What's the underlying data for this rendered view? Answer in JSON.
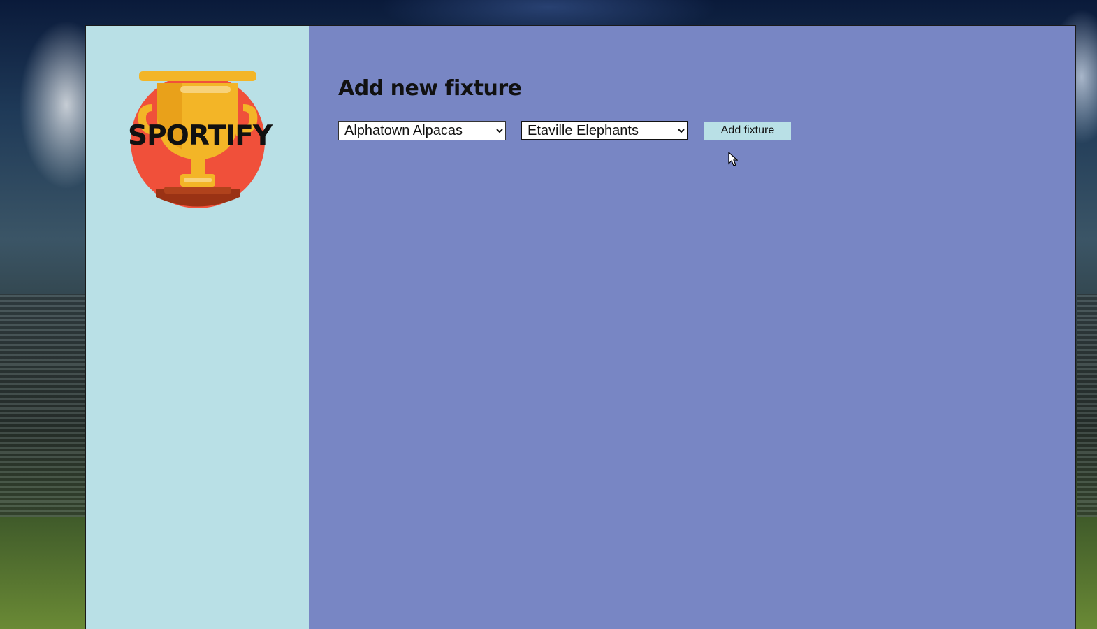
{
  "brand": {
    "name": "SPORTIFY",
    "colors": {
      "trophy": "#f3b527",
      "circle": "#f0503a",
      "base": "#9a3214"
    }
  },
  "main": {
    "title": "Add new fixture",
    "home_team": {
      "selected": "Alphatown Alpacas"
    },
    "away_team": {
      "selected": "Etaville Elephants"
    },
    "add_button_label": "Add fixture"
  },
  "colors": {
    "sidebar_bg": "#b9e0e6",
    "main_bg": "#7886c4",
    "button_bg": "#b9e0e6"
  }
}
